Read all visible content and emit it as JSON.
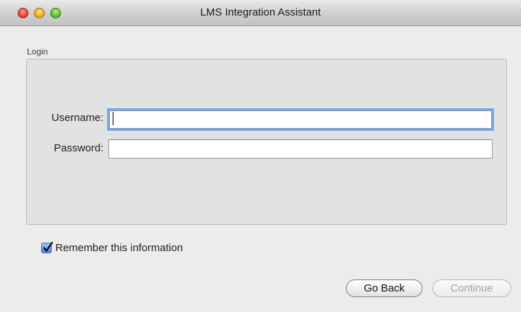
{
  "window": {
    "title": "LMS Integration Assistant"
  },
  "login": {
    "section_label": "Login",
    "username_label": "Username:",
    "username_value": "",
    "password_label": "Password:",
    "password_value": ""
  },
  "remember": {
    "label": "Remember this information",
    "checked": true
  },
  "buttons": {
    "go_back": "Go Back",
    "continue": "Continue"
  },
  "colors": {
    "focus_ring": "#5e92de",
    "checkbox_accent": "#4c8ae0",
    "disabled_text": "#a3a3a3"
  }
}
